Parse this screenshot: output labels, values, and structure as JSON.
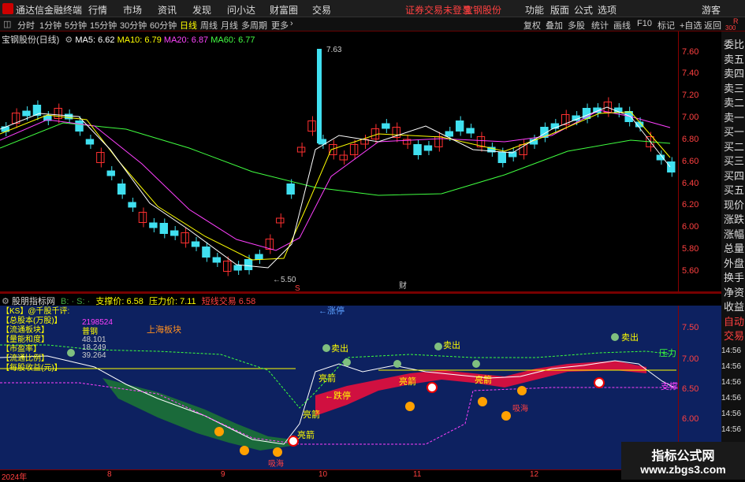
{
  "window": {
    "app_name": "通达信金融终端",
    "menus": [
      "行情",
      "市场",
      "资讯",
      "发现",
      "问小达",
      "财富圈",
      "交易"
    ],
    "alert": "证券交易未登录",
    "stock_name_top": "宝钢股份",
    "right_menus": [
      "功能",
      "版面",
      "公式",
      "选项"
    ],
    "guest": "游客",
    "corner_top": "R",
    "corner_bottom": "300"
  },
  "periods": {
    "items": [
      "分时",
      "1分钟",
      "5分钟",
      "15分钟",
      "30分钟",
      "60分钟",
      "日线",
      "周线",
      "月线",
      "多周期",
      "更多"
    ],
    "active": "日线"
  },
  "toolbar_right": [
    "复权",
    "叠加",
    "多股",
    "统计",
    "画线",
    "F10",
    "标记",
    "+自选",
    "返回"
  ],
  "upper": {
    "title": "宝钢股份(日线)",
    "ma": [
      {
        "label": "MA5:",
        "value": "6.62",
        "color": "#ffffff"
      },
      {
        "label": "MA10:",
        "value": "6.79",
        "color": "#ffff00"
      },
      {
        "label": "MA20:",
        "value": "6.87",
        "color": "#ff40ff"
      },
      {
        "label": "MA60:",
        "value": "6.77",
        "color": "#40ff40"
      }
    ],
    "high_label": "7.63",
    "low_label": "5.50",
    "y_ticks": [
      "7.60",
      "7.40",
      "7.20",
      "7.00",
      "6.80",
      "6.60",
      "6.40",
      "6.20",
      "6.00",
      "5.80",
      "5.60"
    ],
    "markers": [
      "S",
      "财"
    ]
  },
  "lower": {
    "title": "股朋指标网",
    "signal": "B: · S: ·",
    "support_label": "支撑价:",
    "support_value": "6.58",
    "pressure_label": "压力价:",
    "pressure_value": "7.11",
    "trade_label": "短线交易",
    "trade_value": "6.58",
    "y_ticks": [
      "7.50",
      "7.00",
      "6.50",
      "6.00"
    ],
    "left_labels": [
      "【KS】@千股千评:",
      "【总股本(万股)】",
      "【流通板块】",
      "【量能和度】",
      "【市盈率】",
      "【流通比例】",
      "【每股收益(元)】"
    ],
    "left_values": [
      "2198524",
      "普钢",
      "48.101",
      "18.249",
      "39.264"
    ],
    "sector_label": "上海板块",
    "annotations": {
      "zhangting": "←涨停",
      "diezting": "←跌停",
      "liangjian": "亮箭",
      "maichu": "卖出",
      "xilai": "吸海",
      "yali": "压力",
      "zhicheng": "支撑"
    }
  },
  "side_panel": [
    "委比",
    "卖五",
    "卖四",
    "卖三",
    "卖二",
    "卖一",
    "买一",
    "买二",
    "买三",
    "买四",
    "买五",
    "现价",
    "涨跌",
    "涨幅",
    "总量",
    "外盘",
    "换手",
    "净资",
    "收益",
    "自动",
    "交易"
  ],
  "side_times": [
    "14:56",
    "14:56",
    "14:56",
    "14:56",
    "14:56",
    "14:56",
    "14:56",
    "14:56"
  ],
  "dates": [
    "2024年",
    "8",
    "9",
    "10",
    "11",
    "12"
  ],
  "watermark": {
    "line1": "指标公式网",
    "line2": "www.zbgs3.com"
  },
  "colors": {
    "up": "#ff3030",
    "down": "#40e0f0",
    "ma5": "#ffffff",
    "ma10": "#ffff00",
    "ma20": "#ff40ff",
    "ma60": "#40ff40",
    "axis": "#ff4040"
  }
}
